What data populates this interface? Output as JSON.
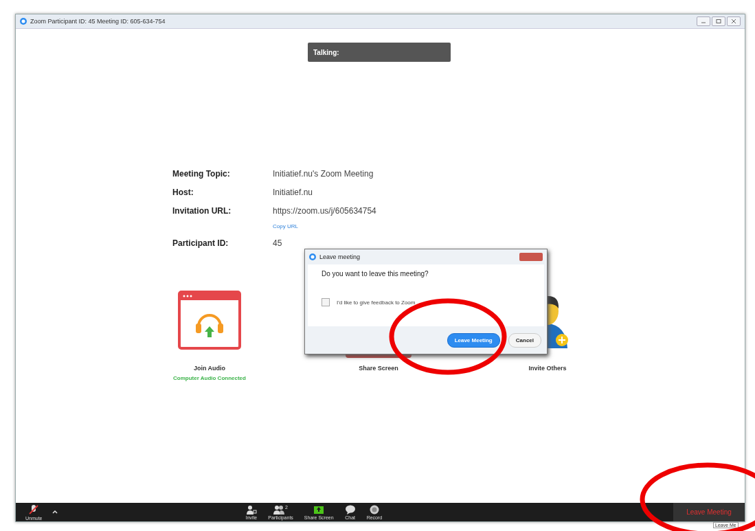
{
  "window": {
    "title": "Zoom Participant ID: 45   Meeting ID: 605-634-754"
  },
  "talking": {
    "label": "Talking:"
  },
  "meeting_info": [
    {
      "label": "Meeting Topic:",
      "value": "Initiatief.nu's Zoom Meeting"
    },
    {
      "label": "Host:",
      "value": "Initiatief.nu"
    },
    {
      "label": "Invitation URL:",
      "value": "https://zoom.us/j/605634754",
      "link": "Copy URL"
    },
    {
      "label": "Participant ID:",
      "value": "45"
    }
  ],
  "actions": [
    {
      "kind": "audio",
      "label": "Join Audio",
      "status": "Computer Audio Connected"
    },
    {
      "kind": "share",
      "label": "Share Screen"
    },
    {
      "kind": "invite",
      "label": "Invite Others"
    }
  ],
  "dialog": {
    "title": "Leave meeting",
    "message": "Do you want to leave this meeting?",
    "checkbox": {
      "label": "I'd like to give feedback to Zoom",
      "checked": false
    },
    "buttons": [
      {
        "kind": "primary",
        "label": "Leave Meeting"
      },
      {
        "kind": "default",
        "label": "Cancel"
      }
    ]
  },
  "toolbar": {
    "left": [
      {
        "kind": "unmute",
        "label": "Unmute"
      }
    ],
    "center": [
      {
        "kind": "invite",
        "label": "Invite"
      },
      {
        "kind": "participants",
        "label": "Participants",
        "count": "2"
      },
      {
        "kind": "share",
        "label": "Share Screen"
      },
      {
        "kind": "chat",
        "label": "Chat"
      },
      {
        "kind": "record",
        "label": "Record"
      }
    ],
    "leave": "Leave Meeting"
  },
  "tooltip": "Leave Me"
}
